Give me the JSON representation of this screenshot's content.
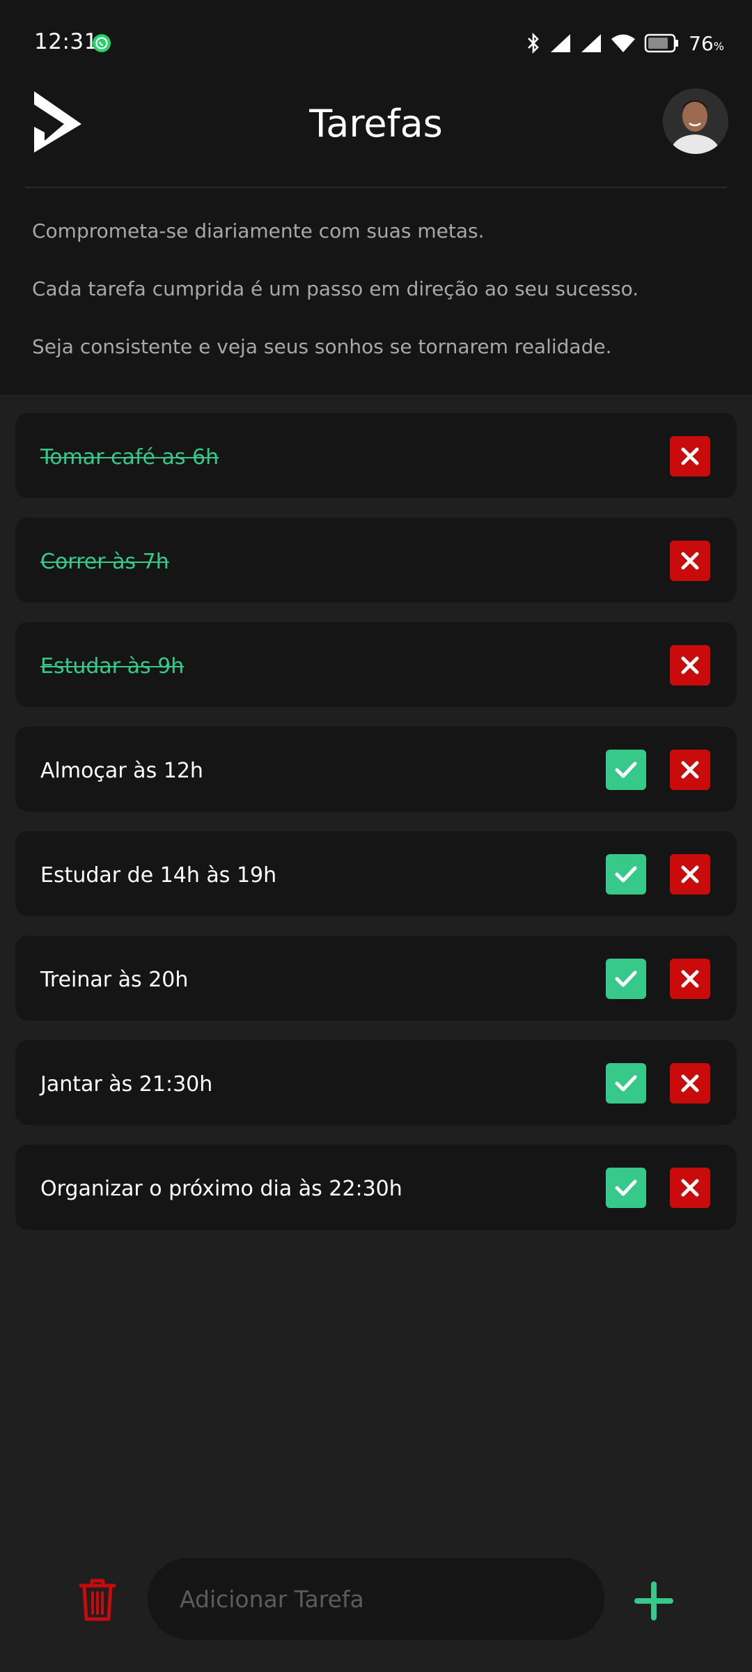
{
  "status": {
    "time": "12:31",
    "battery": "76",
    "battery_unit": "%"
  },
  "header": {
    "title": "Tarefas"
  },
  "intro": [
    "Comprometa-se diariamente com suas metas.",
    "Cada tarefa cumprida é um passo em direção ao seu sucesso.",
    "Seja consistente e veja seus sonhos se tornarem realidade."
  ],
  "tasks": [
    {
      "label": "Tomar café as 6h",
      "done": true
    },
    {
      "label": "Correr às 7h",
      "done": true
    },
    {
      "label": "Estudar às 9h",
      "done": true
    },
    {
      "label": "Almoçar às 12h",
      "done": false
    },
    {
      "label": "Estudar de 14h às 19h",
      "done": false
    },
    {
      "label": "Treinar às 20h",
      "done": false
    },
    {
      "label": "Jantar às 21:30h",
      "done": false
    },
    {
      "label": "Organizar o próximo dia às 22:30h",
      "done": false
    }
  ],
  "add_bar": {
    "placeholder": "Adicionar Tarefa"
  },
  "colors": {
    "accent_green": "#36c98a",
    "delete_red": "#c90b0b",
    "card_bg": "#151515",
    "page_bg": "#1f1f1f"
  },
  "icons": {
    "check": "check-icon",
    "delete": "close-icon",
    "trash": "trash-icon",
    "add": "plus-icon",
    "logo": "play-logo-icon"
  }
}
